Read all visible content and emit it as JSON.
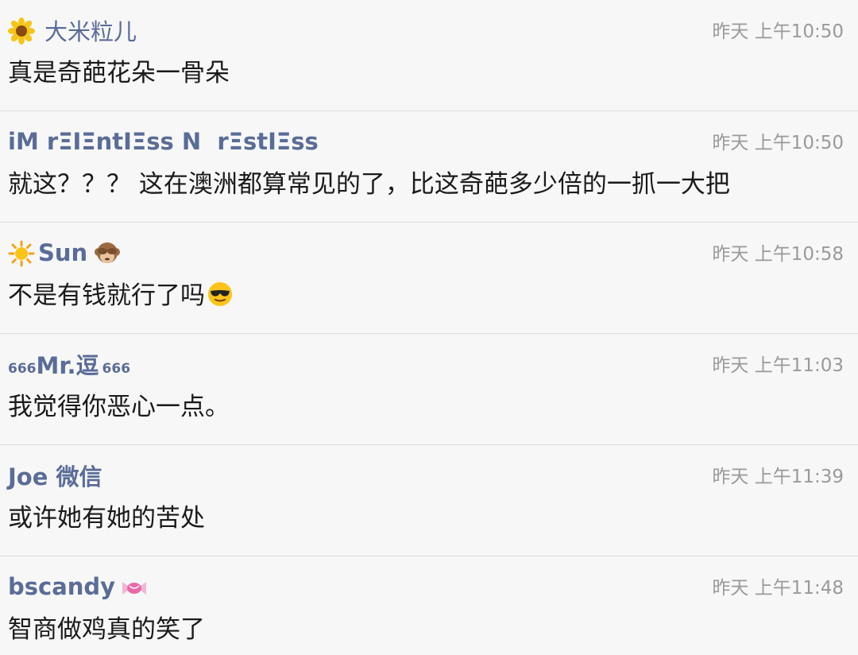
{
  "comments": [
    {
      "user_prefix_icon": "sunflower-icon",
      "user": "大米粒儿",
      "time": "昨天 上午10:50",
      "text": "真是奇葩花朵一骨朵"
    },
    {
      "user": "iM rΞIΞntIΞss N  rΞstIΞss",
      "time": "昨天 上午10:50",
      "text": "就这？？？ 这在澳洲都算常见的了，比这奇葩多少倍的一抓一大把"
    },
    {
      "user_prefix_icon": "sun-icon",
      "user": "Sun",
      "user_suffix_icon": "see-no-evil-monkey-icon",
      "time": "昨天 上午10:58",
      "text": "不是有钱就行了吗",
      "text_suffix_icon": "sunglasses-face-icon"
    },
    {
      "user_prefix": "666",
      "user": "Mr.逗",
      "user_suffix": "666",
      "time": "昨天 上午11:03",
      "text": "我觉得你恶心一点。"
    },
    {
      "user": "Joe 微信",
      "time": "昨天 上午11:39",
      "text": "或许她有她的苦处"
    },
    {
      "user": "bscandy",
      "user_suffix_icon": "candy-icon",
      "time": "昨天 上午11:48",
      "text": "智商做鸡真的笑了"
    }
  ],
  "colors": {
    "background": "#f7f7f7",
    "username": "#5a6c97",
    "timestamp": "#9a9a9a",
    "text": "#1a1a1a",
    "divider": "#dddddd"
  }
}
